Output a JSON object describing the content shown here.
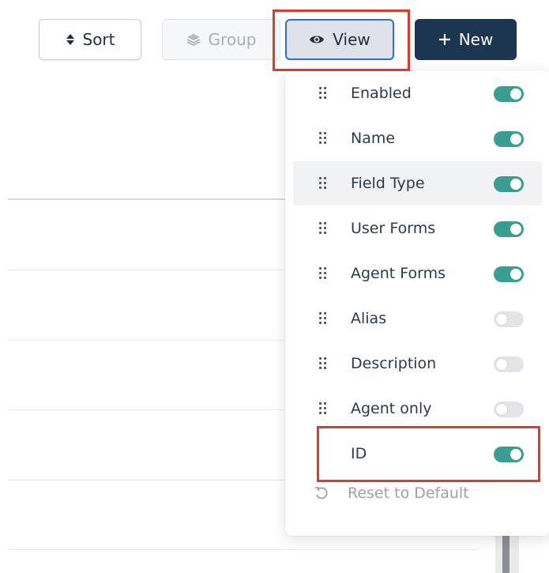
{
  "toolbar": {
    "sort_label": "Sort",
    "group_label": "Group",
    "view_label": "View",
    "new_label": "New"
  },
  "view_menu": {
    "columns": [
      {
        "label": "Enabled",
        "enabled": true,
        "draggable": true
      },
      {
        "label": "Name",
        "enabled": true,
        "draggable": true
      },
      {
        "label": "Field Type",
        "enabled": true,
        "draggable": true,
        "hovered": true
      },
      {
        "label": "User Forms",
        "enabled": true,
        "draggable": true
      },
      {
        "label": "Agent Forms",
        "enabled": true,
        "draggable": true
      },
      {
        "label": "Alias",
        "enabled": false,
        "draggable": true
      },
      {
        "label": "Description",
        "enabled": false,
        "draggable": true
      },
      {
        "label": "Agent only",
        "enabled": false,
        "draggable": true
      },
      {
        "label": "ID",
        "enabled": true,
        "draggable": false
      }
    ],
    "reset_label": "Reset to Default"
  },
  "colors": {
    "toggle_on": "#3a9d91",
    "toggle_off": "#e2e4e7",
    "primary_button": "#1c3550",
    "focus_border": "#2f6fdd",
    "annotation": "#e2392c"
  }
}
